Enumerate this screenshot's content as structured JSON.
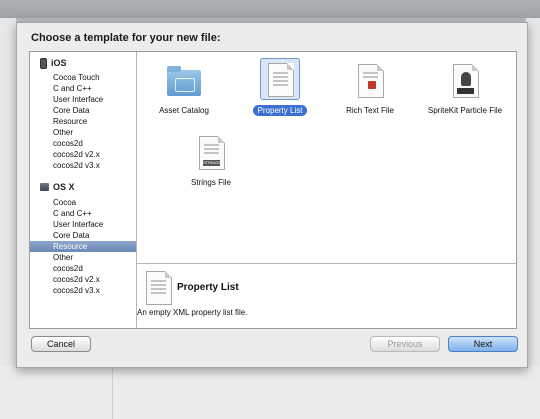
{
  "sheet": {
    "title": "Choose a template for your new file:"
  },
  "sidebar": {
    "groups": [
      {
        "name": "iOS",
        "icon": "iphone-icon",
        "items": [
          "Cocoa Touch",
          "C and C++",
          "User Interface",
          "Core Data",
          "Resource",
          "Other",
          "cocos2d",
          "cocos2d v2.x",
          "cocos2d v3.x"
        ]
      },
      {
        "name": "OS X",
        "icon": "mac-icon",
        "items": [
          "Cocoa",
          "C and C++",
          "User Interface",
          "Core Data",
          "Resource",
          "Other",
          "cocos2d",
          "cocos2d v2.x",
          "cocos2d v3.x"
        ]
      }
    ],
    "selected": "OS X / Resource"
  },
  "templates": [
    {
      "label": "Asset Catalog",
      "icon": "folder-icon"
    },
    {
      "label": "Property List",
      "icon": "document-icon",
      "selected": true
    },
    {
      "label": "Rich Text File",
      "icon": "rich-text-document-icon"
    },
    {
      "label": "SpriteKit Particle File",
      "icon": "sprite-document-icon"
    },
    {
      "label": "Strings File",
      "icon": "strings-document-icon",
      "badge": "STRINGS"
    }
  ],
  "detail": {
    "title": "Property List",
    "description": "An empty XML property list file."
  },
  "buttons": {
    "cancel": "Cancel",
    "previous": "Previous",
    "next": "Next"
  },
  "colors": {
    "selection": "#3b6fd1",
    "sidebar_selection": "#7b96c2",
    "primary_button": "#7fb0ec"
  }
}
